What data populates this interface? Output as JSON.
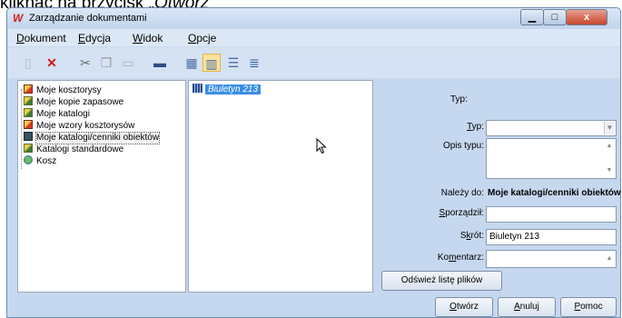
{
  "caption": {
    "prefix": "kliknąć na przycisk „",
    "emphasis": "Otwórz"
  },
  "window": {
    "title": "Zarządzanie dokumentami",
    "close_glyph": "x"
  },
  "menu": [
    {
      "label": "Dokument",
      "accel": "D",
      "rest": "okument"
    },
    {
      "label": "Edycja",
      "accel": "E",
      "rest": "dycja"
    },
    {
      "label": "Widok",
      "accel": "W",
      "rest": "idok"
    },
    {
      "label": "Opcje",
      "accel": "O",
      "rest": "pcje"
    }
  ],
  "toolbar": {
    "icons": [
      "new-document-icon",
      "delete-icon",
      "cut-icon",
      "copy-icon",
      "paste-icon",
      "properties-icon",
      "large-icons-view-icon",
      "small-icons-view-icon",
      "list-view-icon",
      "details-view-icon"
    ],
    "active": "small-icons-view-icon"
  },
  "tree": {
    "items": [
      {
        "label": "Moje kosztorysy",
        "icon": "folder-estimates-icon"
      },
      {
        "label": "Moje kopie zapasowe",
        "icon": "folder-backups-icon"
      },
      {
        "label": "Moje katalogi",
        "icon": "folder-catalogs-icon"
      },
      {
        "label": "Moje wzory kosztorysów",
        "icon": "folder-templates-icon"
      },
      {
        "label": "Moje katalogi/cenniki obiektów",
        "icon": "folder-object-catalogs-icon",
        "selected": true
      },
      {
        "label": "Katalogi standardowe",
        "icon": "folder-standard-catalogs-icon"
      },
      {
        "label": "Kosz",
        "icon": "recycle-bin-icon"
      }
    ]
  },
  "file_list": {
    "items": [
      {
        "label": "Biuletyn 213",
        "icon": "catalog-file-icon",
        "selected": true
      }
    ]
  },
  "properties": {
    "header": "Typ:",
    "typ": {
      "label_accel": "T",
      "label_rest": "yp:",
      "value": ""
    },
    "opis_typu": {
      "label": "Opis typu:",
      "value": ""
    },
    "nalezy_do": {
      "label": "Należy do:",
      "value": "Moje katalogi/cenniki obiektów"
    },
    "sporzadzil": {
      "label_accel": "S",
      "label_rest": "porządził:",
      "value": ""
    },
    "skrot": {
      "label_pre": "S",
      "label_accel": "k",
      "label_rest": "rót:",
      "value": "Biuletyn 213"
    },
    "komentarz": {
      "label_pre": "Ko",
      "label_accel": "m",
      "label_rest": "entarz:",
      "value": ""
    },
    "refresh_button": "Odśwież listę plików"
  },
  "buttons": {
    "open": {
      "accel": "O",
      "rest": "twórz"
    },
    "cancel": {
      "accel": "A",
      "rest": "nuluj"
    },
    "help": {
      "accel": "P",
      "rest": "omoc"
    }
  }
}
